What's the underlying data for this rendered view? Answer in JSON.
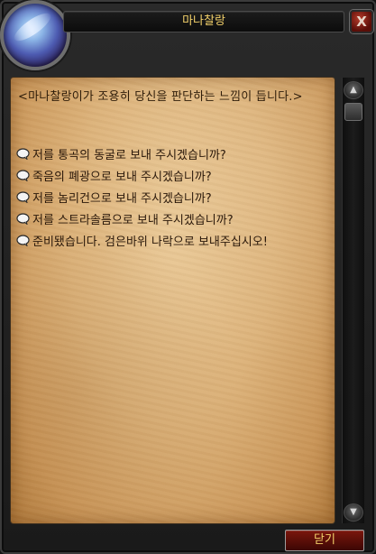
{
  "window": {
    "title": "마나찰랑",
    "close_symbol": "X"
  },
  "npc": {
    "greeting": "<마나찰랑이가 조용히 당신을 판단하는 느낌이 듭니다.>"
  },
  "options": [
    {
      "label": "저를 통곡의 동굴로 보내 주시겠습니까?",
      "icon": "chat-bubble-icon"
    },
    {
      "label": "죽음의 폐광으로 보내 주시겠습니까?",
      "icon": "chat-bubble-icon"
    },
    {
      "label": "저를 놈리건으로 보내 주시겠습니까?",
      "icon": "chat-bubble-icon"
    },
    {
      "label": "저를 스트라솔름으로 보내 주시겠습니까?",
      "icon": "chat-bubble-icon"
    },
    {
      "label": "준비됐습니다. 검은바위 나락으로 보내주십시오!",
      "icon": "chat-bubble-icon"
    }
  ],
  "scrollbar": {
    "up_symbol": "▲",
    "down_symbol": "▼"
  },
  "footer": {
    "close_label": "닫기"
  },
  "colors": {
    "title_text": "#f3d16a",
    "parchment": "#dcb27a",
    "option_text": "#2a180a",
    "button_red": "#7b160d"
  }
}
